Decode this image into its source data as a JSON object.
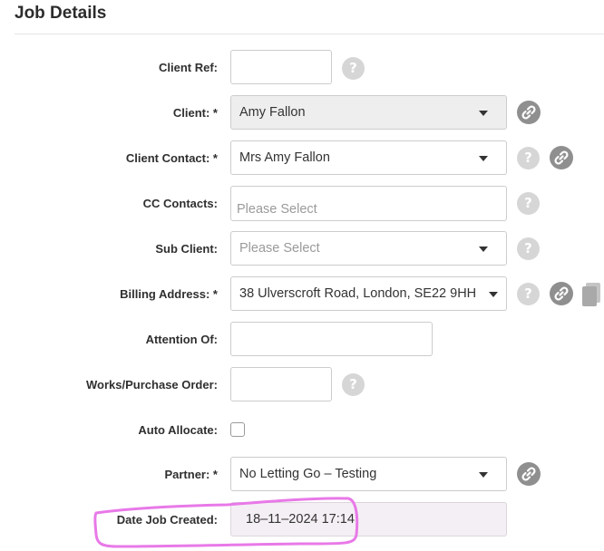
{
  "section": {
    "title": "Job Details"
  },
  "fields": {
    "client_ref": {
      "label": "Client Ref:",
      "value": ""
    },
    "client": {
      "label": "Client: *",
      "value": "Amy Fallon"
    },
    "client_contact": {
      "label": "Client Contact: *",
      "value": "Mrs Amy Fallon"
    },
    "cc_contacts": {
      "label": "CC Contacts:",
      "placeholder": "Please Select"
    },
    "sub_client": {
      "label": "Sub Client:",
      "placeholder": "Please Select"
    },
    "billing_address": {
      "label": "Billing Address: *",
      "value": "38 Ulverscroft Road, London, SE22 9HH"
    },
    "attention_of": {
      "label": "Attention Of:",
      "value": ""
    },
    "works_purchase_order": {
      "label": "Works/Purchase Order:",
      "value": ""
    },
    "auto_allocate": {
      "label": "Auto Allocate:",
      "checked": false
    },
    "partner": {
      "label": "Partner: *",
      "value": "No Letting Go – Testing"
    },
    "date_job_created": {
      "label": "Date Job Created:",
      "value": "18–11–2024 17:14"
    }
  },
  "icons": {
    "help": "?",
    "link": "link-icon",
    "copy": "copy-icon"
  },
  "colors": {
    "highlight": "#e879e8",
    "help_bg": "#d6d6d6",
    "link_bg": "#8f8f8f",
    "disabled_bg": "#eeeeee"
  }
}
